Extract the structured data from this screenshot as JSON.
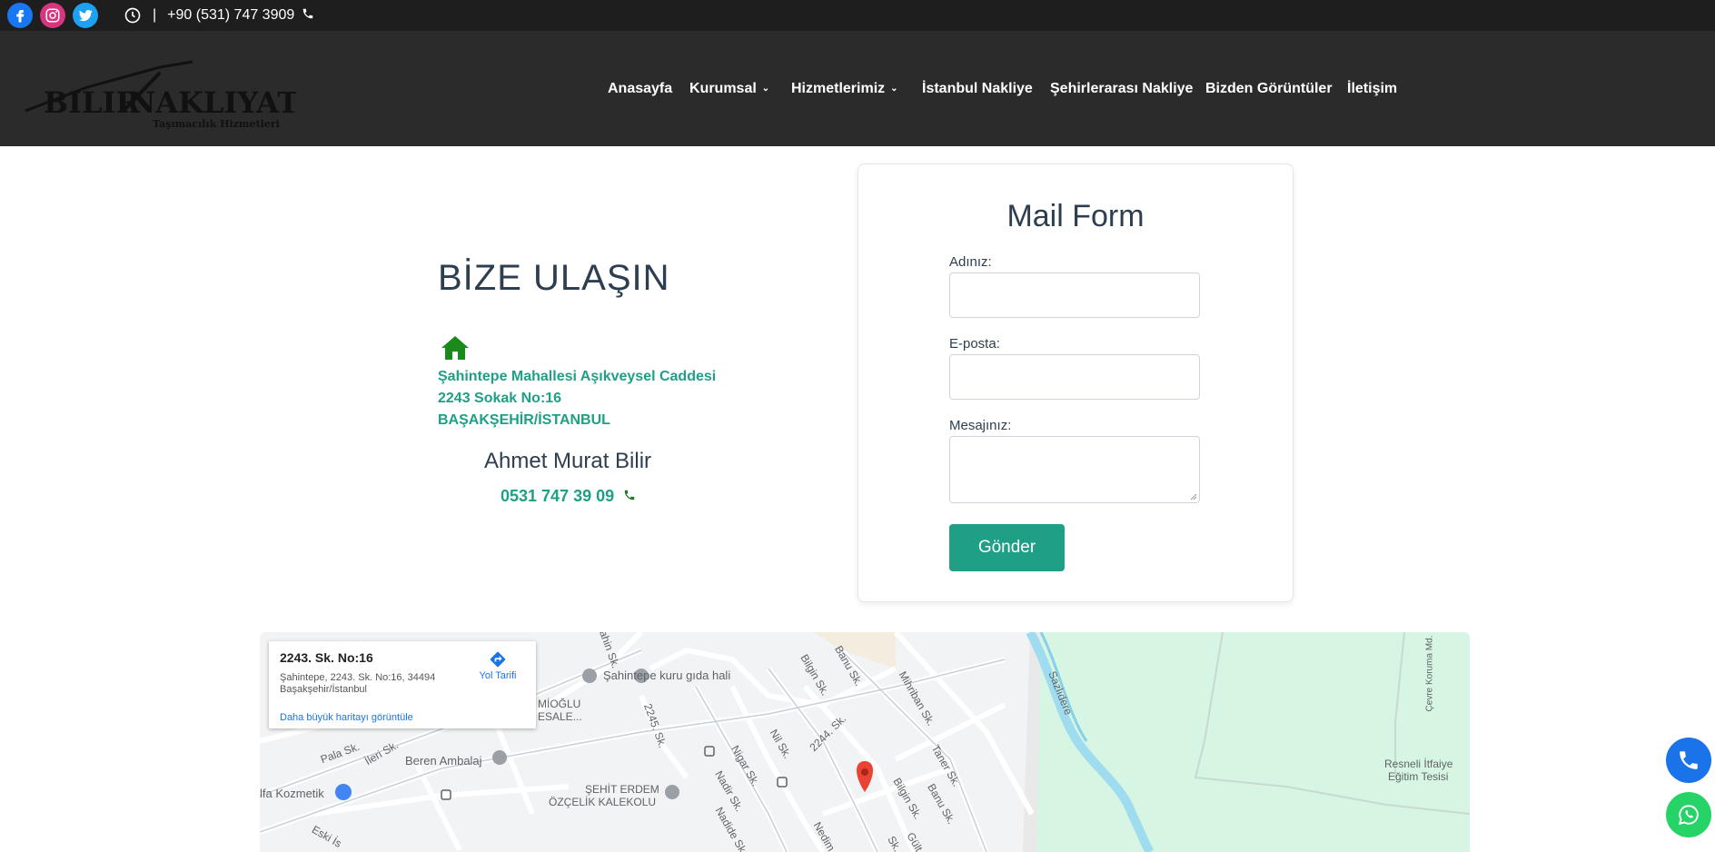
{
  "topbar": {
    "social": [
      "facebook-icon",
      "instagram-icon",
      "twitter-icon"
    ],
    "phone": "+90 (531) 747 3909",
    "separator": "|"
  },
  "logo": {
    "main": "BILIR NAKLIYAT",
    "sub": "Taşımacılık Hizmetleri"
  },
  "nav": {
    "items": [
      {
        "label": "Anasayfa",
        "dropdown": false
      },
      {
        "label": "Kurumsal",
        "dropdown": true
      },
      {
        "label": "Hizmetlerimiz",
        "dropdown": true
      },
      {
        "label": "İstanbul Nakliye",
        "dropdown": false
      },
      {
        "label": "Şehirlerarası Nakliye",
        "dropdown": false
      },
      {
        "label": "Bizden Görüntüler",
        "dropdown": false
      },
      {
        "label": "İletişim",
        "dropdown": false
      }
    ]
  },
  "contact": {
    "title": "BİZE ULAŞIN",
    "address_line1": "Şahintepe Mahallesi Aşıkveysel Caddesi",
    "address_line2": "2243 Sokak No:16",
    "address_line3": "BAŞAKŞEHİR/İSTANBUL",
    "person": "Ahmet Murat Bilir",
    "phone": "0531 747 39 09"
  },
  "form": {
    "title": "Mail Form",
    "name_label": "Adınız:",
    "email_label": "E-posta:",
    "message_label": "Mesajınız:",
    "submit": "Gönder"
  },
  "map": {
    "place_title": "2243. Sk. No:16",
    "place_address": "Şahintepe, 2243. Sk. No:16, 34494 Başakşehir/İstanbul",
    "directions": "Yol Tarifi",
    "larger_map": "Daha büyük haritayı görüntüle",
    "labels": {
      "sahintepe": "Şahintepe kuru gıda hali",
      "beren": "Beren Ambalaj",
      "sehit": "ŞEHİT ERDEM",
      "ozcelik": "ÖZÇELİK KALEKOLU",
      "kozmetik": "lfa Kozmetik",
      "miroglu": "MİOĞLU",
      "mesale": "ESALE...",
      "sazlidere": "Sazlıdere",
      "resneli1": "Resneli İtfaiye",
      "resneli2": "Eğitim Tesisi",
      "cevre": "Çevre Koruma Md.",
      "pala": "Pala Sk.",
      "ileri": "İleri Sk.",
      "nigar": "Nigar Sk.",
      "nadir": "Nadir Sk.",
      "nadide": "Nadide Sk.",
      "nil": "Nil Sk.",
      "s2244": "2244. Sk.",
      "s2245": "2245. Sk.",
      "bilgin": "Bilgin Sk.",
      "bilgin2": "Bilgin Sk.",
      "banu": "Banu Sk.",
      "banu2": "Banu Sk.",
      "mihriban": "Mihriban Sk.",
      "taner": "Taner Sk.",
      "nedim": "Nedim",
      "sahin": "Şahin Sk.",
      "eski": "Eski İs",
      "gul": "Gült",
      "sk": "Sk."
    }
  }
}
